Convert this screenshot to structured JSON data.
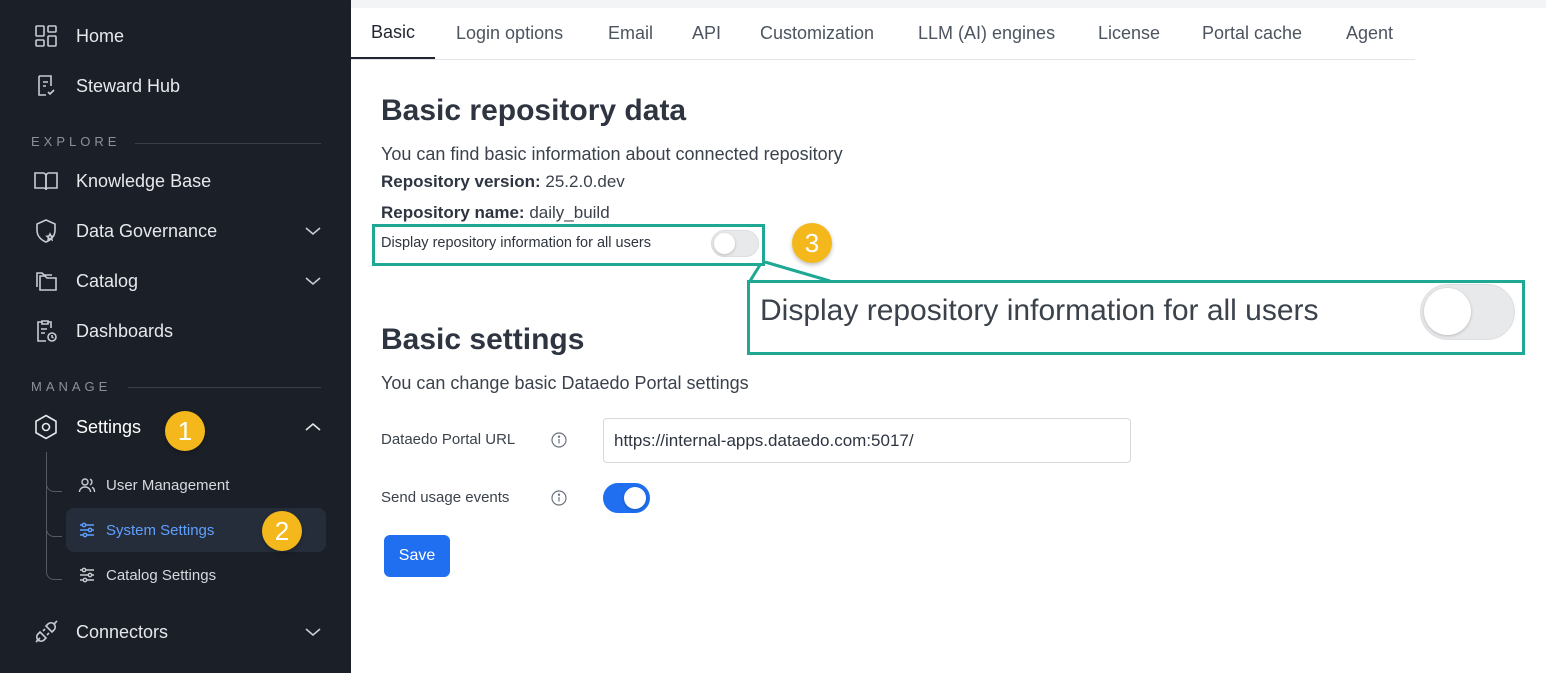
{
  "sidebar": {
    "home": {
      "label": "Home",
      "icon": "grid-icon"
    },
    "steward_hub": {
      "label": "Steward Hub",
      "icon": "clipboard-check-icon"
    },
    "explore_label": "EXPLORE",
    "knowledge_base": {
      "label": "Knowledge Base",
      "icon": "book-icon"
    },
    "data_governance": {
      "label": "Data Governance",
      "icon": "shield-star-icon"
    },
    "catalog": {
      "label": "Catalog",
      "icon": "folders-icon"
    },
    "dashboards": {
      "label": "Dashboards",
      "icon": "clipboard-chart-icon"
    },
    "manage_label": "MANAGE",
    "settings": {
      "label": "Settings",
      "icon": "hexagon-gear-icon"
    },
    "sub_items": [
      {
        "label": "User Management",
        "icon": "users-icon"
      },
      {
        "label": "System Settings",
        "icon": "sliders-icon"
      },
      {
        "label": "Catalog Settings",
        "icon": "sliders-icon"
      }
    ],
    "connectors": {
      "label": "Connectors",
      "icon": "plug-icon"
    }
  },
  "badges": {
    "one": "1",
    "two": "2",
    "three": "3"
  },
  "tabs": [
    "Basic",
    "Login options",
    "Email",
    "API",
    "Customization",
    "LLM (AI) engines",
    "License",
    "Portal cache",
    "Agent"
  ],
  "active_tab": "Basic",
  "repo": {
    "title": "Basic repository data",
    "description": "You can find basic information about connected repository",
    "version_label": "Repository version:",
    "version_value": "25.2.0.dev",
    "name_label": "Repository name:",
    "name_value": "daily_build",
    "display_toggle_label": "Display repository information for all users",
    "display_toggle_on": false,
    "zoom_label": "Display repository information for all users"
  },
  "basic_settings": {
    "title": "Basic settings",
    "description": "You can change basic Dataedo Portal settings",
    "url_label": "Dataedo Portal URL",
    "url_value": "https://internal-apps.dataedo.com:5017/",
    "usage_label": "Send usage events",
    "usage_on": true,
    "save_label": "Save"
  },
  "colors": {
    "sidebar_bg": "#1b1f27",
    "accent": "#1f6ff0",
    "highlight": "#1fa893",
    "badge": "#f5b81c",
    "active_sub_text": "#5fa0ff"
  }
}
